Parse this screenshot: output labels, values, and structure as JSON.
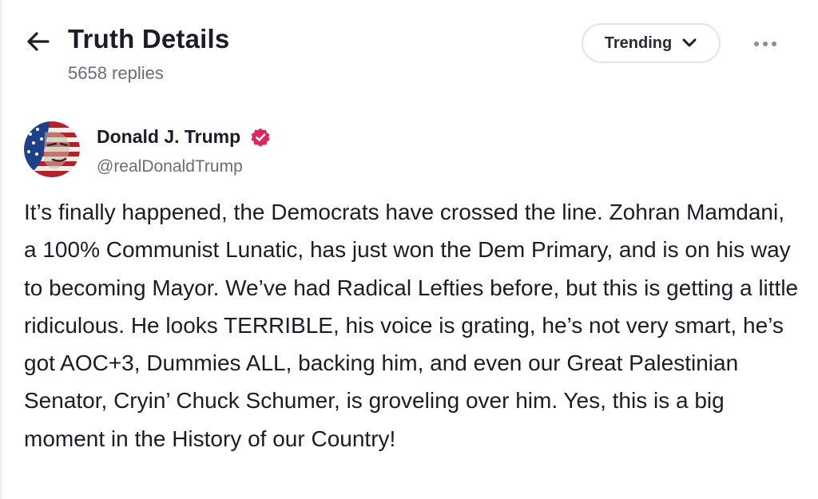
{
  "header": {
    "title": "Truth Details",
    "reply_count": "5658 replies",
    "back_icon": "arrow-left-icon",
    "sort": {
      "selected": "Trending",
      "icon": "chevron-down-icon"
    },
    "more_icon": "more-horizontal-icon"
  },
  "post": {
    "author": {
      "name": "Donald J. Trump",
      "handle": "@realDonaldTrump",
      "verified_icon": "verified-badge-icon",
      "verified_color": "#e0245e"
    },
    "text": "It’s finally happened, the Democrats have crossed the line. Zohran Mamdani, a 100% Communist Lunatic, has just won the Dem Primary, and is on his way to becoming Mayor. We’ve had Radical Lefties before, but this is getting a little ridiculous. He looks TERRIBLE, his voice is grating, he’s not very smart, he’s got AOC+3, Dummies ALL, backing him, and even our Great Palestinian Senator, Cryin’ Chuck Schumer, is groveling over him. Yes, this is a big moment in the History of our Country!"
  },
  "colors": {
    "text_primary": "#1c1c28",
    "text_secondary": "#6b6b7b",
    "border": "#e3e3ea",
    "accent": "#e0245e"
  }
}
